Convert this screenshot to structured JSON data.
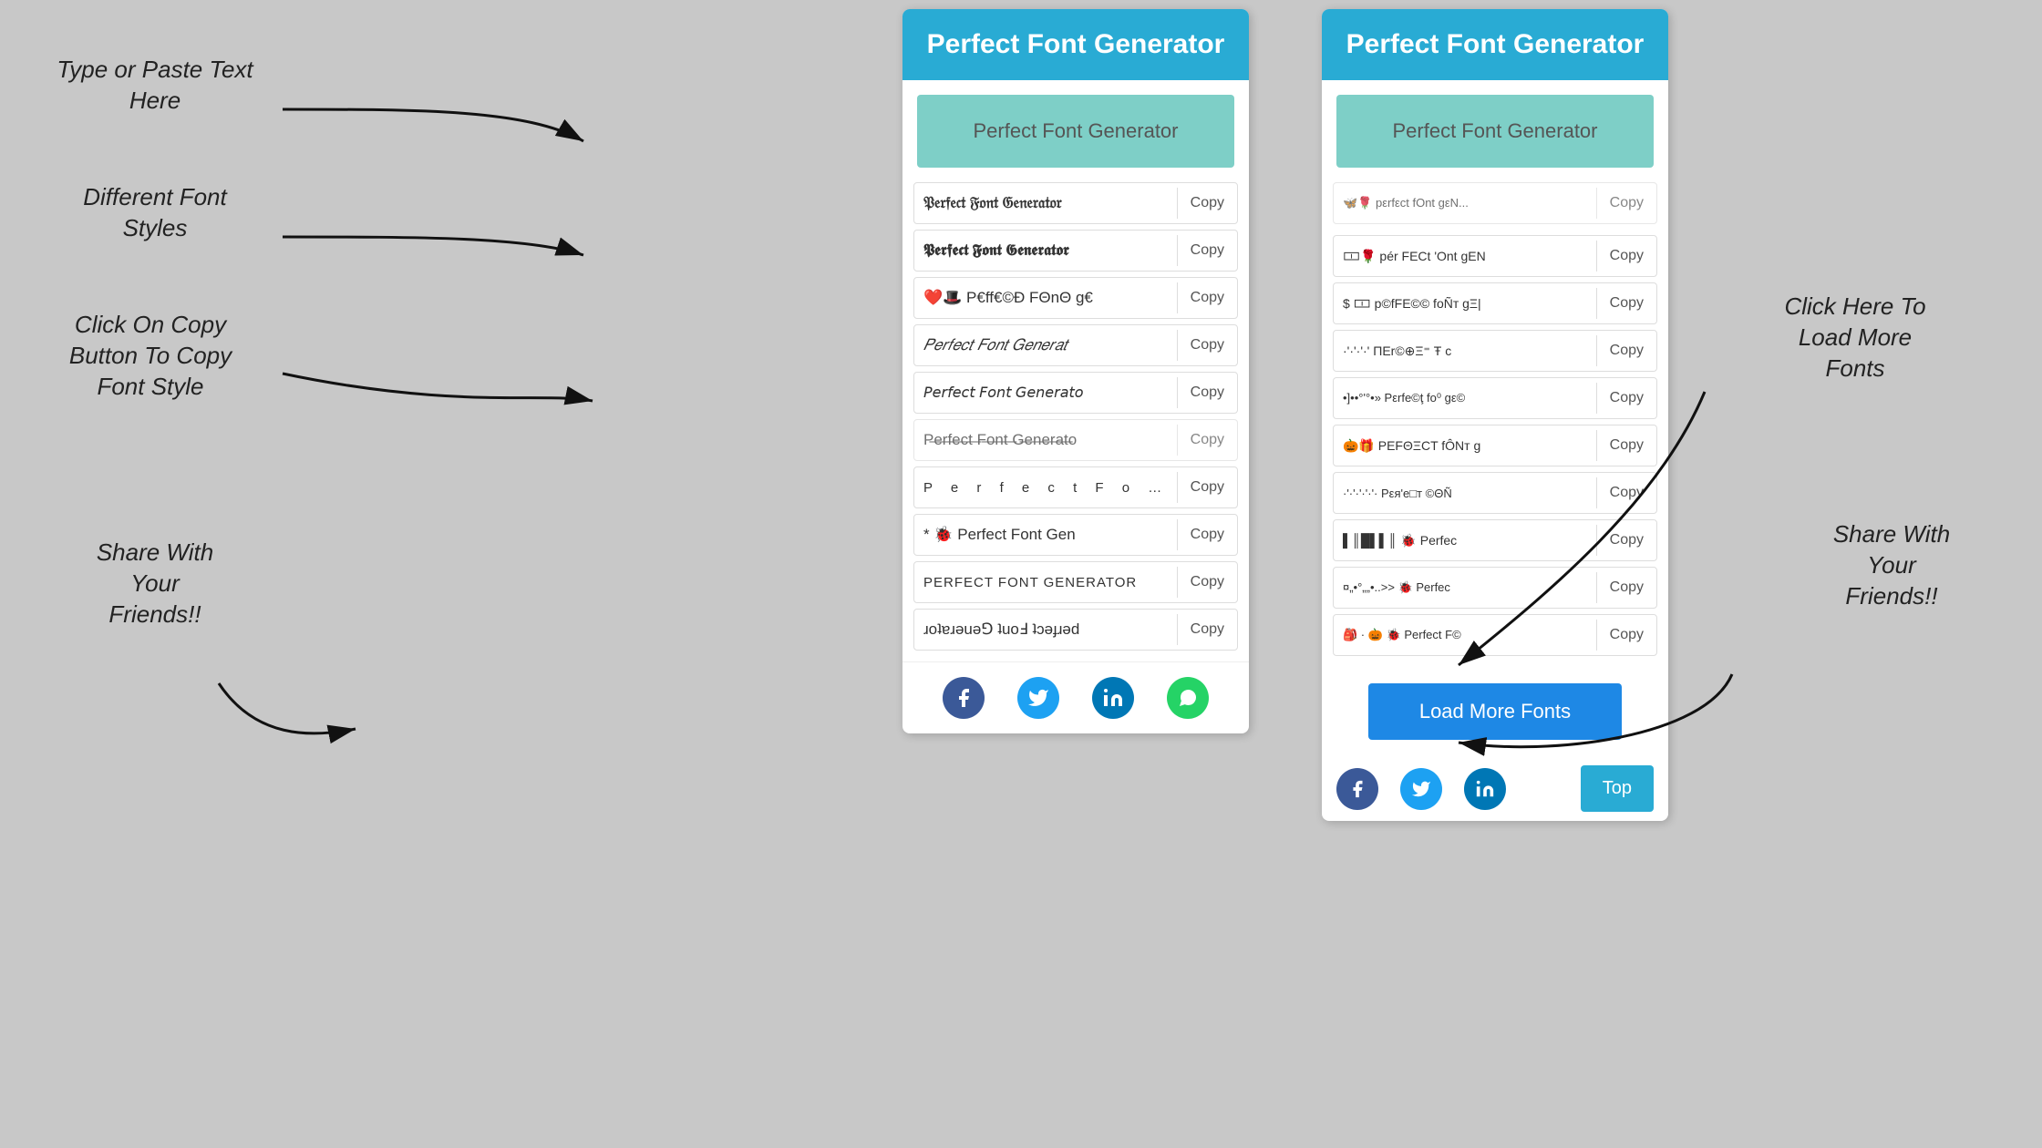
{
  "app": {
    "title": "Perfect Font Generator",
    "bg_color": "#c8c8c8"
  },
  "panel1": {
    "header": "Perfect Font Generator",
    "input_placeholder": "Perfect Font Generator",
    "copy_label": "Copy",
    "fonts": [
      {
        "text": "𝔓𝔢𝔯𝔣𝔢𝔠𝔱 𝔉𝔬𝔫𝔱 𝔊𝔢𝔫𝔢𝔯𝔞𝔱𝔬𝔯",
        "style": "gothic"
      },
      {
        "text": "𝕻𝖊𝖗𝖋𝖊𝖈𝖙 𝕱𝖔𝖓𝖙 𝕲𝖊𝖓𝖊𝖗𝖆𝖙𝖔𝖗",
        "style": "fraktur"
      },
      {
        "text": "❤️🎩 P€ff€©Ð FΘnΘ g€",
        "style": "emoji"
      },
      {
        "text": "𝑃𝑒𝑟𝑓𝑒𝑐𝑡 𝐹𝑜𝑛𝑡 𝐺𝑒𝑛𝑒𝑟𝑎𝑡",
        "style": "italic"
      },
      {
        "text": "𝘗𝘦𝘳𝘧𝘦𝘤𝘵 𝘍𝘰𝘯𝘵 𝘎𝘦𝘯𝘦𝘳𝘢𝘵𝘰",
        "style": "italic2"
      },
      {
        "text": "Perfect Font Generator",
        "style": "strikethrough"
      },
      {
        "text": "P e r f e c t  F o n t",
        "style": "spaced"
      },
      {
        "text": "* 🐞 Perfect Font Gen",
        "style": "emoji2"
      },
      {
        "text": "PERFECT FONT GENERATOR",
        "style": "caps"
      },
      {
        "text": "ɹoʇɐɹǝuǝ⅁ ʇuoℲ ʇɔǝɟɹǝd",
        "style": "reverse"
      }
    ],
    "social": [
      "facebook",
      "twitter",
      "linkedin",
      "whatsapp"
    ]
  },
  "panel2": {
    "header": "Perfect Font Generator",
    "input_placeholder": "Perfect Font Generator",
    "copy_label": "Copy",
    "fonts": [
      {
        "text": "🦋🌹 pÉrfECt 'Ont gEN",
        "style": "emoji"
      },
      {
        "text": "$ 🀱 p©fFE©© foÑт ɡΞ|",
        "style": "emoji2"
      },
      {
        "text": "·'·'·'·' ΠEr©⊕Ξ⁼ Ŧ c",
        "style": "dots"
      },
      {
        "text": "•]••°'°•» Pεrfe©ţ fo⁰ gε©",
        "style": "dots2"
      },
      {
        "text": "🎃🎁 PEFΘΞCT fÔNт g",
        "style": "emoji3"
      },
      {
        "text": "·'·'·'·'·'· Pεя'e□т ©ΘÑ",
        "style": "dots3"
      },
      {
        "text": "▌║█▌▌║ 🐞 Perfec",
        "style": "bars"
      },
      {
        "text": "¤„•°„„•..>> 🐞 Perfec",
        "style": "dots4"
      },
      {
        "text": "🎒 · 🎃 🐞 Perfect F©",
        "style": "emoji4"
      }
    ],
    "load_more_label": "Load More Fonts",
    "top_label": "Top",
    "social": [
      "facebook",
      "twitter",
      "linkedin"
    ]
  },
  "labels": {
    "type_or_paste": "Type or Paste Text\nHere",
    "different_fonts": "Different Font\nStyles",
    "click_copy": "Click On Copy\nButton To Copy\nFont Style",
    "share": "Share With\nYour\nFriends!!",
    "click_load_more": "Click Here To\nLoad More\nFonts",
    "share2": "Share With\nYour\nFriends!!"
  }
}
